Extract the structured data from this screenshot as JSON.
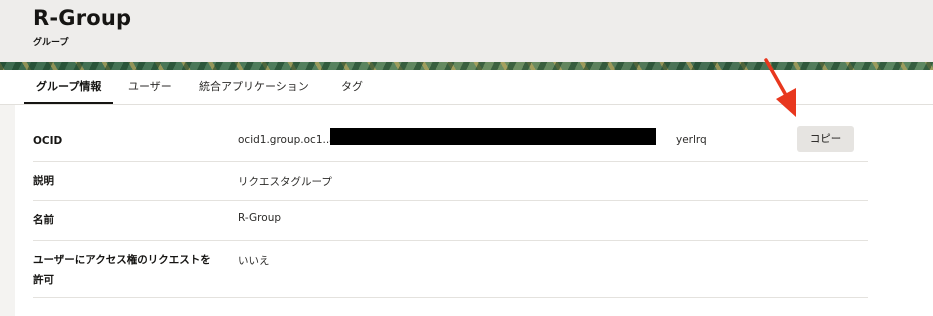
{
  "header": {
    "title": "R-Group",
    "subtitle": "グループ"
  },
  "tabs": [
    {
      "label": "グループ情報",
      "active": true
    },
    {
      "label": "ユーザー",
      "active": false
    },
    {
      "label": "統合アプリケーション",
      "active": false
    },
    {
      "label": "タグ",
      "active": false
    }
  ],
  "details": {
    "ocid": {
      "label": "OCID",
      "value_prefix": "ocid1.group.oc1..aaa",
      "value_suffix": "yerlrq",
      "copy_label": "コピー"
    },
    "description": {
      "label": "説明",
      "value": "リクエスタグループ"
    },
    "name": {
      "label": "名前",
      "value": "R-Group"
    },
    "access_request": {
      "label_line1": "ユーザーにアクセス権のリクエストを",
      "label_line2": "許可",
      "value": "いいえ"
    }
  },
  "colors": {
    "accent_arrow": "#e8371e",
    "tab_active": "#161513",
    "background": "#f4f3f1"
  }
}
